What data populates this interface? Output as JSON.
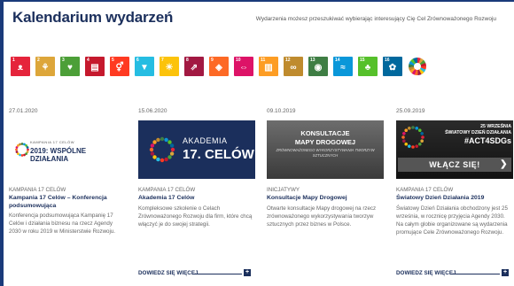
{
  "header": {
    "title": "Kalendarium wydarzeń",
    "note": "Wydarzenia możesz przeszukiwać wybierając interesujący Cię Cel Zrównoważonego Rozwoju"
  },
  "goals": [
    {
      "n": "1",
      "color": "#e5243b",
      "sym": "ᴥ"
    },
    {
      "n": "2",
      "color": "#dda63a",
      "sym": "⚘"
    },
    {
      "n": "3",
      "color": "#4c9f38",
      "sym": "♥"
    },
    {
      "n": "4",
      "color": "#c5192d",
      "sym": "▤"
    },
    {
      "n": "5",
      "color": "#ff3a21",
      "sym": "⚥"
    },
    {
      "n": "6",
      "color": "#26bde2",
      "sym": "▼"
    },
    {
      "n": "7",
      "color": "#fcc30b",
      "sym": "☀"
    },
    {
      "n": "8",
      "color": "#a21942",
      "sym": "⇗"
    },
    {
      "n": "9",
      "color": "#fd6925",
      "sym": "◈"
    },
    {
      "n": "10",
      "color": "#dd1367",
      "sym": "⇔"
    },
    {
      "n": "11",
      "color": "#fd9d24",
      "sym": "▥"
    },
    {
      "n": "12",
      "color": "#bf8b2e",
      "sym": "∞"
    },
    {
      "n": "13",
      "color": "#3f7e44",
      "sym": "◉"
    },
    {
      "n": "14",
      "color": "#0a97d9",
      "sym": "≈"
    },
    {
      "n": "15",
      "color": "#56c02b",
      "sym": "♣"
    },
    {
      "n": "16",
      "color": "#00689d",
      "sym": "✿"
    },
    {
      "n": "17",
      "color": "#19486a",
      "sym": "✲"
    }
  ],
  "cards": [
    {
      "date": "27.01.2020",
      "category": "KAMPANIA 17 CELÓW",
      "title": "Kampania 17 Celów – Konferencja podsumowująca",
      "desc": "Konferencja podsumowująca Kampanię 17 Celów i działania biznesu na rzecz Agendy 2030 w roku 2019 w Ministerstwie Rozwoju.",
      "more": "",
      "image": {
        "line1": "KAMPANIA 17 CELÓW",
        "line2": "2019: WSPÓLNE DZIAŁANIA"
      }
    },
    {
      "date": "15.06.2020",
      "category": "KAMPANIA 17 CELÓW",
      "title": "Akademia 17 Celów",
      "desc": "Kompleksowe szkolenie o Celach Zrównoważonego Rozwoju dla firm, które chcą włączyć je do swojej strategii.",
      "more": "DOWIEDZ SIĘ WIĘCEJ",
      "image": {
        "line1": "AKADEMIA",
        "line2": "17. CELÓW"
      }
    },
    {
      "date": "09.10.2019",
      "category": "INICJATYWY",
      "title": "Konsultacje Mapy Drogowej",
      "desc": "Otwarte konsultacje Mapy drogowej na rzecz zrównoważonego wykorzystywania tworzyw sztucznych przez biznes w Polsce.",
      "more": "",
      "image": {
        "line1": "KONSULTACJE",
        "line2": "MAPY DROGOWEJ",
        "line3": "ZRÓWNOWAŻONEGO WYKORZYSTYWANIA TWORZYW SZTUCZNYCH"
      }
    },
    {
      "date": "25.09.2019",
      "category": "KAMPANIA 17 CELÓW",
      "title": "Światowy Dzień Działania 2019",
      "desc": "Światowy Dzień Działania obchodzony jest 25 września, w rocznicę przyjęcia Agendy 2030. Na całym globie organizowane są wydarzenia promujące Cele Zrównoważonego Rozwoju.",
      "more": "DOWIEDZ SIĘ WIĘCEJ",
      "image": {
        "line1": "25 WRZEŚNIA",
        "line2": "ŚWIATOWY DZIEŃ DZIAŁANIA",
        "line3": "#ACT4SDGs",
        "button": "WŁĄCZ SIĘ!"
      }
    }
  ]
}
